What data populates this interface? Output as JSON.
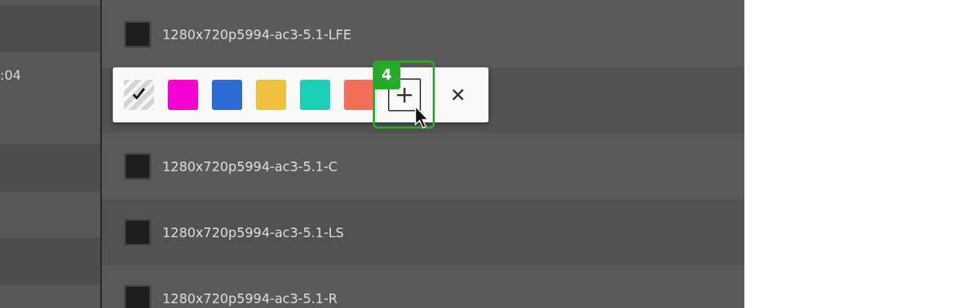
{
  "sidebar": {
    "time_label": ":04"
  },
  "tracks": [
    {
      "kind": "track",
      "name": "1280x720p5994-ac3-5.1-LFE",
      "checked": false
    },
    {
      "kind": "covered"
    },
    {
      "kind": "track",
      "name": "1280x720p5994-ac3-5.1-C",
      "checked": false
    },
    {
      "kind": "track",
      "name": "1280x720p5994-ac3-5.1-LS",
      "checked": false
    },
    {
      "kind": "track",
      "name": "1280x720p5994-ac3-5.1-R",
      "checked": false
    }
  ],
  "color_picker": {
    "swatches": [
      {
        "kind": "none",
        "selected": true
      },
      {
        "kind": "color",
        "color": "#f200d6",
        "selected": false
      },
      {
        "kind": "color",
        "color": "#2b6cd4",
        "selected": false
      },
      {
        "kind": "color",
        "color": "#ecc23e",
        "selected": false
      },
      {
        "kind": "color",
        "color": "#1ccfb6",
        "selected": false
      },
      {
        "kind": "color",
        "color": "#f26f58",
        "selected": false
      }
    ],
    "add_button": "+",
    "close_button": "✕",
    "step_badge": "4"
  }
}
